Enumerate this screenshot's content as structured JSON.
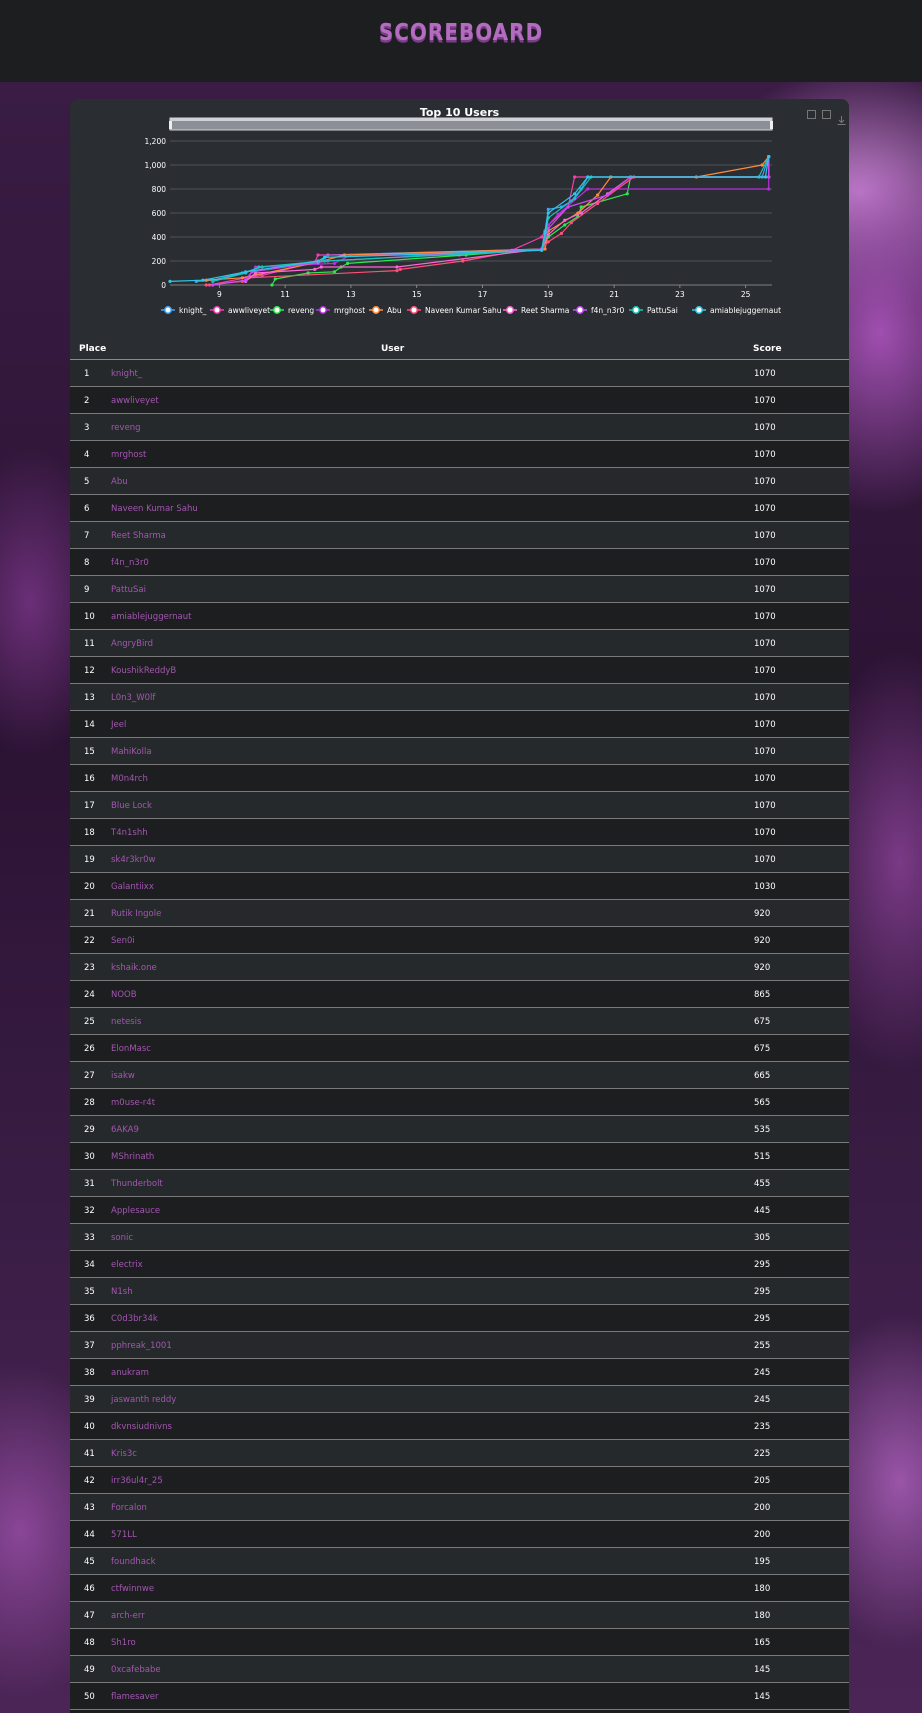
{
  "header": {
    "title": "SCOREBOARD"
  },
  "chart_data": {
    "type": "line",
    "title": "Top 10 Users",
    "x_ticks": [
      "9",
      "11",
      "13",
      "15",
      "17",
      "19",
      "21",
      "23",
      "25"
    ],
    "y_ticks": [
      "0",
      "200",
      "400",
      "600",
      "800",
      "1,000",
      "1,200"
    ],
    "xlim": [
      7.5,
      25.8
    ],
    "ylim": [
      0,
      1200
    ],
    "legend_position": "bottom",
    "series": [
      {
        "name": "knight_",
        "color": "#3fa7f5",
        "points": [
          [
            8.3,
            30
          ],
          [
            8.8,
            40
          ],
          [
            9.7,
            100
          ],
          [
            10.3,
            150
          ],
          [
            12,
            180
          ],
          [
            12.3,
            250
          ],
          [
            18.8,
            300
          ],
          [
            18.9,
            450
          ],
          [
            19,
            630
          ],
          [
            19.4,
            650
          ],
          [
            19.7,
            700
          ],
          [
            20,
            800
          ],
          [
            20.2,
            900
          ],
          [
            25.5,
            900
          ],
          [
            25.7,
            1070
          ]
        ]
      },
      {
        "name": "awwliveyet",
        "color": "#f43fb0",
        "points": [
          [
            8.7,
            0
          ],
          [
            9.8,
            60
          ],
          [
            10.3,
            80
          ],
          [
            11.9,
            190
          ],
          [
            12,
            250
          ],
          [
            16.3,
            250
          ],
          [
            17.9,
            290
          ],
          [
            18.8,
            400
          ],
          [
            19,
            500
          ],
          [
            19.6,
            650
          ],
          [
            19.8,
            900
          ],
          [
            25.7,
            900
          ],
          [
            25.7,
            1070
          ]
        ]
      },
      {
        "name": "reveng",
        "color": "#2ee84f",
        "points": [
          [
            10.6,
            0
          ],
          [
            10.7,
            50
          ],
          [
            11.7,
            100
          ],
          [
            12.5,
            110
          ],
          [
            12.7,
            150
          ],
          [
            12.9,
            180
          ],
          [
            16.5,
            250
          ],
          [
            18.8,
            300
          ],
          [
            19,
            400
          ],
          [
            19.5,
            500
          ],
          [
            19.9,
            570
          ],
          [
            20,
            650
          ],
          [
            21.4,
            760
          ],
          [
            21.5,
            900
          ],
          [
            25.7,
            900
          ],
          [
            25.7,
            1070
          ]
        ]
      },
      {
        "name": "mrghost",
        "color": "#b72fe0",
        "points": [
          [
            9.8,
            50
          ],
          [
            10.1,
            150
          ],
          [
            12.5,
            180
          ],
          [
            13,
            250
          ],
          [
            18.8,
            290
          ],
          [
            19,
            500
          ],
          [
            19.3,
            590
          ],
          [
            20.2,
            800
          ],
          [
            25.7,
            800
          ],
          [
            25.7,
            1070
          ]
        ]
      },
      {
        "name": "Abu",
        "color": "#ff8a3d",
        "points": [
          [
            8.6,
            40
          ],
          [
            9.7,
            60
          ],
          [
            12,
            190
          ],
          [
            12.8,
            250
          ],
          [
            18.9,
            300
          ],
          [
            19,
            450
          ],
          [
            19.9,
            600
          ],
          [
            20.5,
            750
          ],
          [
            20.9,
            900
          ],
          [
            23.5,
            900
          ],
          [
            25.5,
            1000
          ],
          [
            25.7,
            1070
          ]
        ]
      },
      {
        "name": "Naveen Kumar Sahu",
        "color": "#ff4f7a",
        "points": [
          [
            8.6,
            0
          ],
          [
            9.7,
            30
          ],
          [
            9.9,
            60
          ],
          [
            14.4,
            120
          ],
          [
            14.5,
            130
          ],
          [
            16.4,
            200
          ],
          [
            18,
            280
          ],
          [
            18.8,
            300
          ],
          [
            19,
            360
          ],
          [
            19.4,
            430
          ],
          [
            19.7,
            520
          ],
          [
            20.5,
            680
          ],
          [
            21.6,
            900
          ],
          [
            25.7,
            900
          ],
          [
            25.7,
            1070
          ]
        ]
      },
      {
        "name": "Reet Sharma",
        "color": "#ff66d6",
        "points": [
          [
            9.8,
            30
          ],
          [
            10.1,
            100
          ],
          [
            11.9,
            130
          ],
          [
            12.1,
            150
          ],
          [
            14.4,
            150
          ],
          [
            18.8,
            300
          ],
          [
            19,
            420
          ],
          [
            19.5,
            540
          ],
          [
            20,
            600
          ],
          [
            20.8,
            760
          ],
          [
            21.5,
            900
          ],
          [
            25.7,
            900
          ],
          [
            25.7,
            1070
          ]
        ]
      },
      {
        "name": "f4n_n3r0",
        "color": "#c94cf5",
        "points": [
          [
            8.8,
            0
          ],
          [
            9.8,
            40
          ],
          [
            10,
            110
          ],
          [
            12.3,
            200
          ],
          [
            18.8,
            300
          ],
          [
            19,
            470
          ],
          [
            19.6,
            650
          ],
          [
            20.8,
            750
          ],
          [
            21.5,
            900
          ],
          [
            25.7,
            900
          ],
          [
            25.7,
            1070
          ]
        ]
      },
      {
        "name": "PattuSai",
        "color": "#19c4b7",
        "points": [
          [
            8.8,
            30
          ],
          [
            9.8,
            100
          ],
          [
            10.2,
            150
          ],
          [
            12.2,
            200
          ],
          [
            18.8,
            290
          ],
          [
            18.9,
            400
          ],
          [
            19,
            560
          ],
          [
            19.8,
            720
          ],
          [
            20.3,
            900
          ],
          [
            25.4,
            900
          ],
          [
            25.7,
            1070
          ]
        ]
      },
      {
        "name": "amiablejuggernaut",
        "color": "#2fc6e8",
        "points": [
          [
            7.5,
            30
          ],
          [
            8.5,
            40
          ],
          [
            9.8,
            110
          ],
          [
            12,
            200
          ],
          [
            12.2,
            230
          ],
          [
            18.8,
            290
          ],
          [
            18.9,
            440
          ],
          [
            19,
            600
          ],
          [
            19.8,
            760
          ],
          [
            20.2,
            900
          ],
          [
            25.6,
            900
          ],
          [
            25.7,
            1070
          ]
        ]
      }
    ]
  },
  "table": {
    "headers": {
      "place": "Place",
      "user": "User",
      "score": "Score"
    },
    "rows": [
      {
        "place": "1",
        "user": "knight_",
        "score": "1070"
      },
      {
        "place": "2",
        "user": "awwliveyet",
        "score": "1070"
      },
      {
        "place": "3",
        "user": "reveng",
        "score": "1070"
      },
      {
        "place": "4",
        "user": "mrghost",
        "score": "1070"
      },
      {
        "place": "5",
        "user": "Abu",
        "score": "1070"
      },
      {
        "place": "6",
        "user": "Naveen Kumar Sahu",
        "score": "1070"
      },
      {
        "place": "7",
        "user": "Reet Sharma",
        "score": "1070"
      },
      {
        "place": "8",
        "user": "f4n_n3r0",
        "score": "1070"
      },
      {
        "place": "9",
        "user": "PattuSai",
        "score": "1070"
      },
      {
        "place": "10",
        "user": "amiablejuggernaut",
        "score": "1070"
      },
      {
        "place": "11",
        "user": "AngryBird",
        "score": "1070"
      },
      {
        "place": "12",
        "user": "KoushikReddyB",
        "score": "1070"
      },
      {
        "place": "13",
        "user": "L0n3_W0lf",
        "score": "1070"
      },
      {
        "place": "14",
        "user": "Jeel",
        "score": "1070"
      },
      {
        "place": "15",
        "user": "MahiKolla",
        "score": "1070"
      },
      {
        "place": "16",
        "user": "M0n4rch",
        "score": "1070"
      },
      {
        "place": "17",
        "user": "Blue Lock",
        "score": "1070"
      },
      {
        "place": "18",
        "user": "T4n1shh",
        "score": "1070"
      },
      {
        "place": "19",
        "user": "sk4r3kr0w",
        "score": "1070"
      },
      {
        "place": "20",
        "user": "Galantiixx",
        "score": "1030"
      },
      {
        "place": "21",
        "user": "Rutik Ingole",
        "score": "920"
      },
      {
        "place": "22",
        "user": "Sen0i",
        "score": "920"
      },
      {
        "place": "23",
        "user": "kshaik.one",
        "score": "920"
      },
      {
        "place": "24",
        "user": "NOOB",
        "score": "865"
      },
      {
        "place": "25",
        "user": "netesis",
        "score": "675"
      },
      {
        "place": "26",
        "user": "ElonMasc",
        "score": "675"
      },
      {
        "place": "27",
        "user": "isakw",
        "score": "665"
      },
      {
        "place": "28",
        "user": "m0use-r4t",
        "score": "565"
      },
      {
        "place": "29",
        "user": "6AKA9",
        "score": "535"
      },
      {
        "place": "30",
        "user": "MShrinath",
        "score": "515"
      },
      {
        "place": "31",
        "user": "Thunderbolt",
        "score": "455"
      },
      {
        "place": "32",
        "user": "Applesauce",
        "score": "445"
      },
      {
        "place": "33",
        "user": "sonic",
        "score": "305"
      },
      {
        "place": "34",
        "user": "electrix",
        "score": "295"
      },
      {
        "place": "35",
        "user": "N1sh",
        "score": "295"
      },
      {
        "place": "36",
        "user": "C0d3br34k",
        "score": "295"
      },
      {
        "place": "37",
        "user": "pphreak_1001",
        "score": "255"
      },
      {
        "place": "38",
        "user": "anukram",
        "score": "245"
      },
      {
        "place": "39",
        "user": "jaswanth reddy",
        "score": "245"
      },
      {
        "place": "40",
        "user": "dkvnsiudnivns",
        "score": "235"
      },
      {
        "place": "41",
        "user": "Kris3c",
        "score": "225"
      },
      {
        "place": "42",
        "user": "irr36ul4r_25",
        "score": "205"
      },
      {
        "place": "43",
        "user": "Forcalon",
        "score": "200"
      },
      {
        "place": "44",
        "user": "571LL",
        "score": "200"
      },
      {
        "place": "45",
        "user": "foundhack",
        "score": "195"
      },
      {
        "place": "46",
        "user": "ctfwinnwe",
        "score": "180"
      },
      {
        "place": "47",
        "user": "arch-err",
        "score": "180"
      },
      {
        "place": "48",
        "user": "Sh1ro",
        "score": "165"
      },
      {
        "place": "49",
        "user": "0xcafebabe",
        "score": "145"
      },
      {
        "place": "50",
        "user": "flamesaver",
        "score": "145"
      }
    ]
  },
  "toolbar_icons": [
    "zoom-icon",
    "reset-zoom-icon",
    "download-icon"
  ]
}
